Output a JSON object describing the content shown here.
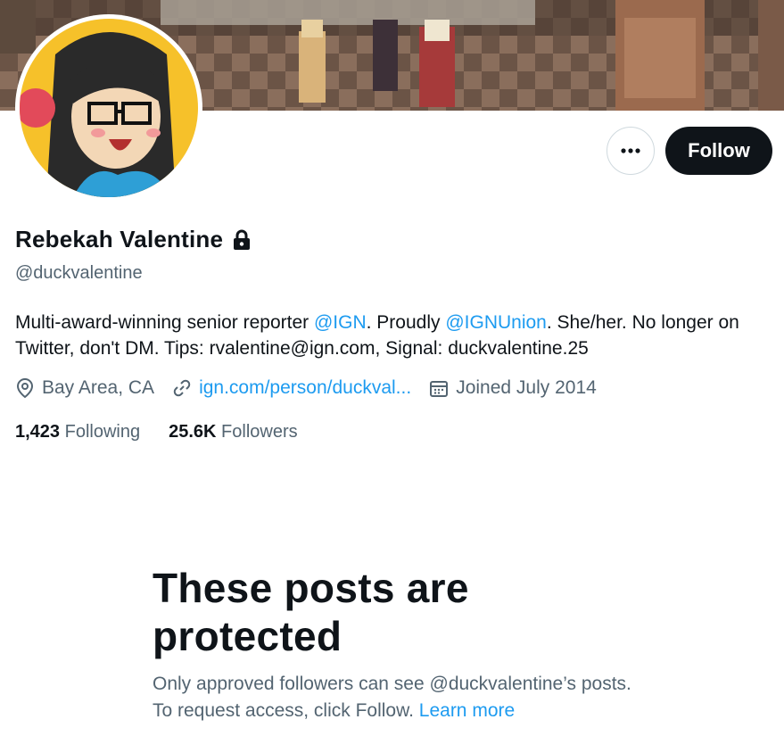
{
  "profile": {
    "name": "Rebekah Valentine",
    "handle": "@duckvalentine",
    "bio": {
      "part1": "Multi-award-winning senior reporter ",
      "mention1": "@IGN",
      "part2": ". Proudly ",
      "mention2": "@IGNUnion",
      "part3": ". She/her. No longer on Twitter, don't DM. Tips: rvalentine@ign.com, Signal: duckvalentine.25"
    },
    "location": "Bay Area, CA",
    "website": "ign.com/person/duckval...",
    "joined": "Joined July 2014",
    "following_count": "1,423",
    "following_label": "Following",
    "followers_count": "25.6K",
    "followers_label": "Followers"
  },
  "actions": {
    "more_label": "•••",
    "follow_label": "Follow"
  },
  "protected": {
    "title": "These posts are protected",
    "desc": "Only approved followers can see @duckvalentine’s posts. To request access, click Follow. ",
    "learn_more": "Learn more"
  },
  "colors": {
    "text_primary": "#0f1419",
    "text_secondary": "#536471",
    "link": "#1d9bf0",
    "button_dark": "#0f1419"
  }
}
